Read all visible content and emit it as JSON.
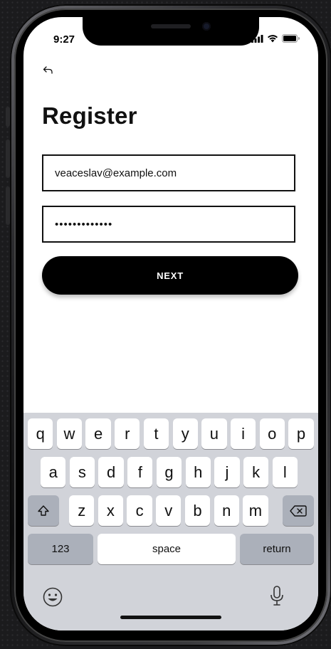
{
  "status": {
    "time": "9:27"
  },
  "page": {
    "title": "Register"
  },
  "form": {
    "email_value": "veaceslav@example.com",
    "password_value": "•••••••••••••",
    "next_label": "NEXT"
  },
  "keyboard": {
    "row1": [
      "q",
      "w",
      "e",
      "r",
      "t",
      "y",
      "u",
      "i",
      "o",
      "p"
    ],
    "row2": [
      "a",
      "s",
      "d",
      "f",
      "g",
      "h",
      "j",
      "k",
      "l"
    ],
    "row3": [
      "z",
      "x",
      "c",
      "v",
      "b",
      "n",
      "m"
    ],
    "numbers_label": "123",
    "space_label": "space",
    "return_label": "return"
  },
  "icons": {
    "back": "back-arrow-icon",
    "signal": "cellular-signal-icon",
    "wifi": "wifi-icon",
    "battery": "battery-icon",
    "shift": "shift-icon",
    "delete": "backspace-icon",
    "emoji": "emoji-icon",
    "mic": "microphone-icon"
  },
  "colors": {
    "primary": "#000000",
    "keyboard_bg": "#d1d3d9",
    "key_dark": "#abb0ba"
  }
}
